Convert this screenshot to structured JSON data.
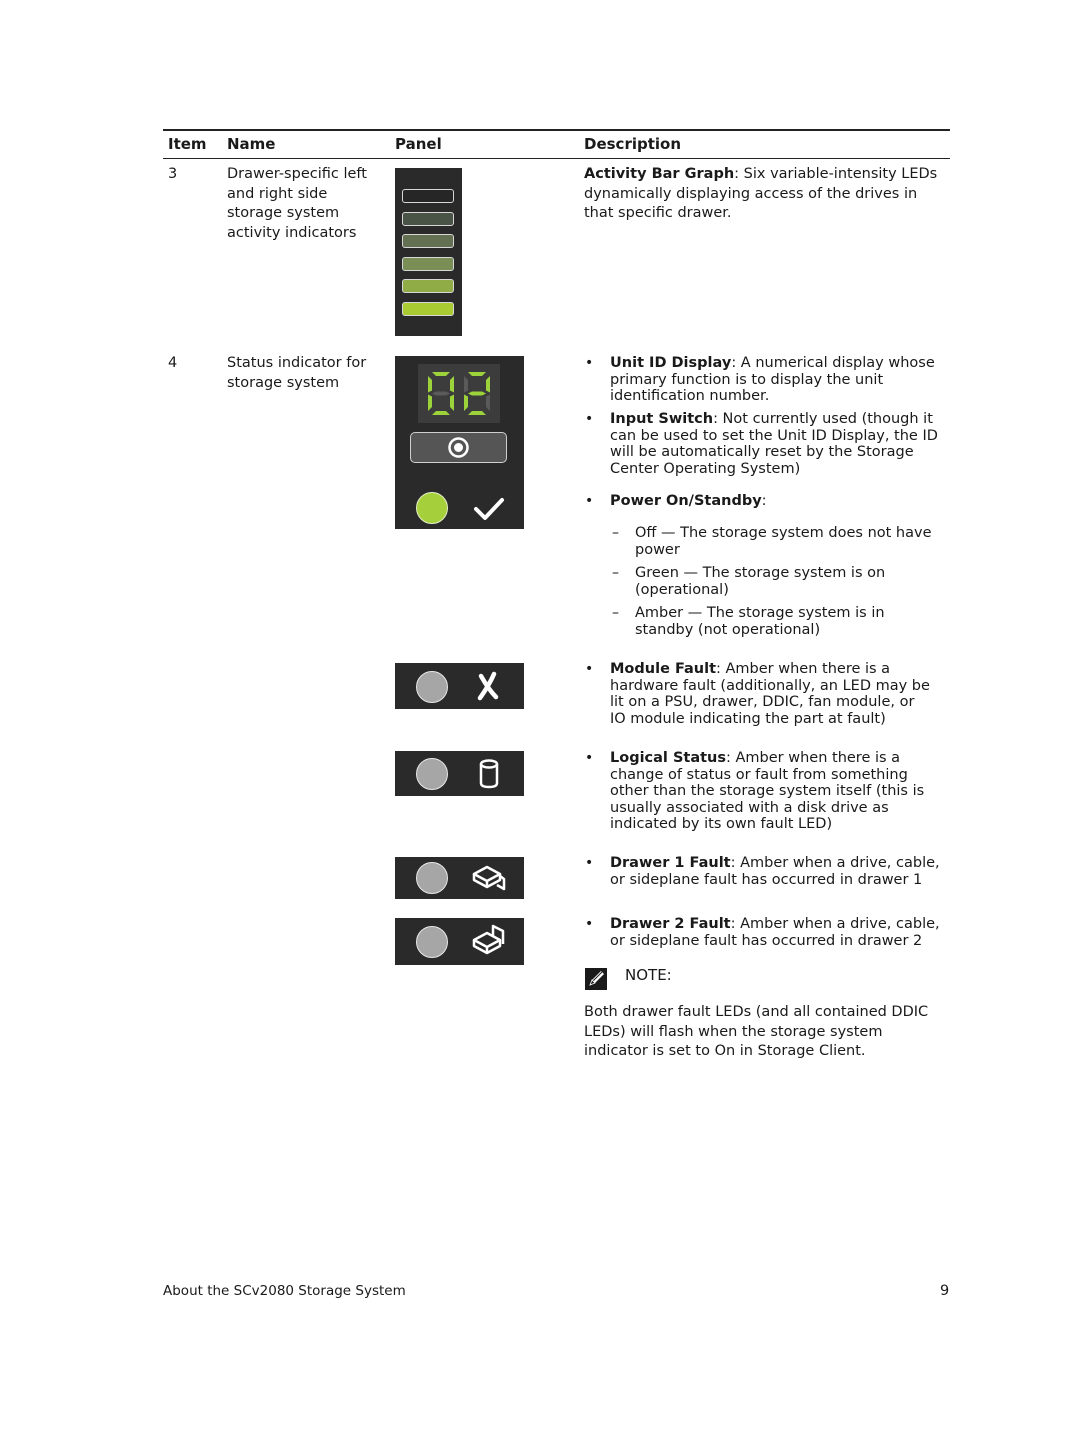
{
  "table": {
    "headers": {
      "item": "Item",
      "name": "Name",
      "panel": "Panel",
      "description": "Description"
    },
    "rows": [
      {
        "item": "3",
        "name_lines": [
          "Drawer-specific left",
          "and right side",
          "storage system",
          "activity indicators"
        ],
        "panel": {
          "type": "activity-bar-graph",
          "bar_colors": [
            "#262626",
            "#4a5446",
            "#637152",
            "#7a8f55",
            "#8fac47",
            "#a9cc33"
          ]
        },
        "description": {
          "term": "Activity Bar Graph",
          "lines": [
            ": Six variable-intensity LEDs",
            "dynamically displaying access of the drives in",
            "that specific drawer."
          ]
        }
      },
      {
        "item": "4",
        "name_lines": [
          "Status indicator for",
          "storage system"
        ],
        "panel": {
          "unit_id_display": "02",
          "display_color": "#9cd23a",
          "power_led_color": "#a6cf3c",
          "fault_led_color": "#a7a6a6",
          "icons": [
            "input-switch-icon",
            "checkmark-icon",
            "module-fault-x-icon",
            "logical-status-cylinder-icon",
            "drawer-1-icon",
            "drawer-2-icon"
          ]
        },
        "description": {
          "bullets": [
            {
              "term": "Unit ID Display",
              "lines": [
                ": A numerical display whose",
                "primary function is to display the unit",
                "identification number."
              ]
            },
            {
              "term": "Input Switch",
              "lines": [
                ": Not currently used (though it",
                "can be used to set the Unit ID Display, the ID",
                "will be automatically reset by the Storage",
                "Center Operating System)"
              ]
            },
            {
              "term": "Power On/Standby",
              "lines": [
                ":"
              ],
              "sub": [
                {
                  "lines": [
                    "Off — The storage system does not have",
                    "power"
                  ]
                },
                {
                  "lines": [
                    "Green — The storage system is on",
                    "(operational)"
                  ]
                },
                {
                  "lines": [
                    "Amber — The storage system is in",
                    "standby (not operational)"
                  ]
                }
              ]
            },
            {
              "term": "Module Fault",
              "lines": [
                ": Amber when there is a",
                "hardware fault (additionally, an LED may be",
                "lit on a PSU, drawer, DDIC, fan module, or",
                "IO module indicating the part at fault)"
              ]
            },
            {
              "term": "Logical Status",
              "lines": [
                ": Amber when there is a",
                "change of status or fault from something",
                "other than the storage system itself (this is",
                "usually associated with a disk drive as",
                "indicated by its own fault LED)"
              ]
            },
            {
              "term": "Drawer 1 Fault",
              "lines": [
                ": Amber when a drive, cable,",
                "or sideplane fault has occurred in drawer 1"
              ]
            },
            {
              "term": "Drawer 2 Fault",
              "lines": [
                ": Amber when a drive, cable,",
                "or sideplane fault has occurred in drawer 2"
              ]
            }
          ],
          "note_label": "NOTE:",
          "note_lines": [
            "Both drawer fault LEDs (and all contained DDIC",
            "LEDs) will flash when the storage system",
            "indicator is set to On in Storage Client."
          ]
        }
      }
    ]
  },
  "footer": {
    "title": "About the SCv2080 Storage System",
    "page": "9"
  }
}
